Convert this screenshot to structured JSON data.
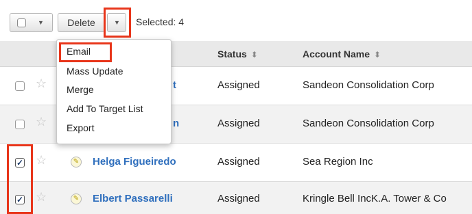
{
  "toolbar": {
    "delete_label": "Delete",
    "selected_text": "Selected: 4"
  },
  "menu": {
    "items": [
      "Email",
      "Mass Update",
      "Merge",
      "Add To Target List",
      "Export"
    ]
  },
  "table": {
    "columns": {
      "status": "Status",
      "account": "Account Name"
    },
    "rows": [
      {
        "checked": false,
        "name_partial": "t",
        "status": "Assigned",
        "account": "Sandeon Consolidation Corp"
      },
      {
        "checked": false,
        "name_partial": "n",
        "status": "Assigned",
        "account": "Sandeon Consolidation Corp"
      },
      {
        "checked": true,
        "name": "Helga Figueiredo",
        "status": "Assigned",
        "account": "Sea Region Inc"
      },
      {
        "checked": true,
        "name": "Elbert Passarelli",
        "status": "Assigned",
        "account": "Kringle Bell IncK.A. Tower & Co"
      }
    ]
  },
  "colors": {
    "highlight": "#e8351a",
    "link": "#2f6fbd",
    "header_bg": "#e9e9e9"
  }
}
